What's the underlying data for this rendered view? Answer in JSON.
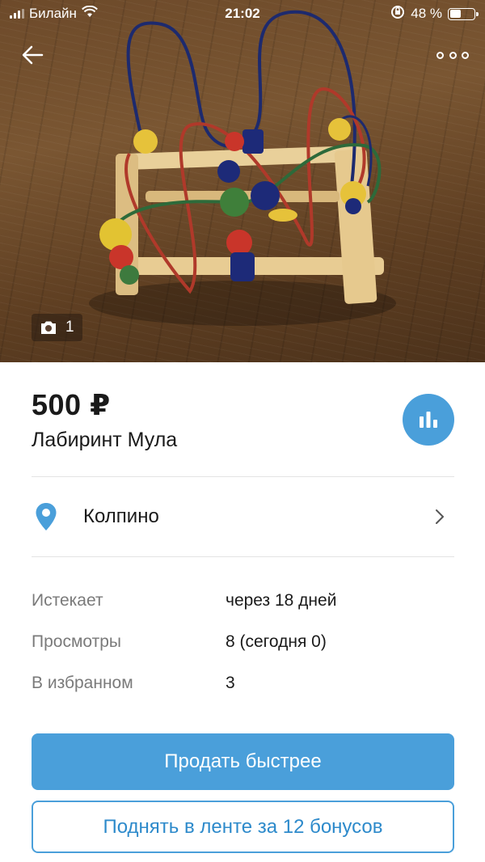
{
  "status_bar": {
    "carrier": "Билайн",
    "time": "21:02",
    "battery": "48 %",
    "battery_level": 0.48
  },
  "photo": {
    "count": "1"
  },
  "listing": {
    "price": "500 ₽",
    "title": "Лабиринт Мула",
    "location": "Колпино"
  },
  "details": [
    {
      "label": "Истекает",
      "value": "через 18 дней"
    },
    {
      "label": "Просмотры",
      "value": "8 (сегодня 0)"
    },
    {
      "label": "В избранном",
      "value": "3"
    }
  ],
  "actions": {
    "primary": "Продать быстрее",
    "secondary": "Поднять в ленте за 12 бонусов"
  },
  "colors": {
    "accent": "#4a9fda"
  }
}
